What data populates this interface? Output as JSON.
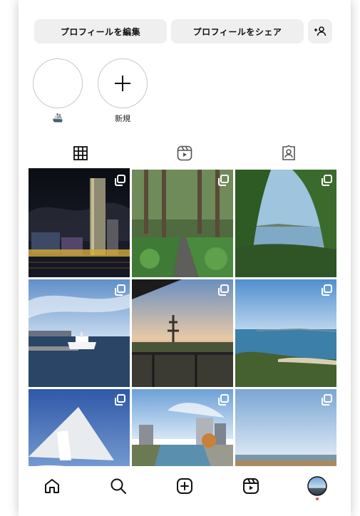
{
  "profile_actions": {
    "edit_label": "プロフィールを編集",
    "share_label": "プロフィールをシェア",
    "add_user_icon": "add-user-icon"
  },
  "highlights": [
    {
      "label": "",
      "icon": "ship-emoji"
    },
    {
      "label": "新規",
      "icon": "plus-icon"
    }
  ],
  "highlight_emoji": "🚢",
  "tabs": [
    {
      "name": "posts",
      "icon": "grid-icon",
      "active": true
    },
    {
      "name": "reels",
      "icon": "reels-icon",
      "active": false
    },
    {
      "name": "tagged",
      "icon": "tagged-person-icon",
      "active": false
    }
  ],
  "posts": [
    {
      "subject": "night city skyline with tower and harbor",
      "multi": true
    },
    {
      "subject": "forest path between tall cedars",
      "multi": true
    },
    {
      "subject": "bay view through green trees",
      "multi": true
    },
    {
      "subject": "white ship at pier under blue sky",
      "multi": true
    },
    {
      "subject": "sunset over trees from balcony",
      "multi": true
    },
    {
      "subject": "sea and islands from hilltop",
      "multi": true
    },
    {
      "subject": "white monument against blue sky",
      "multi": true
    },
    {
      "subject": "river canal with city buildings",
      "multi": true
    },
    {
      "subject": "sandy dunes and calm sea",
      "multi": true
    }
  ],
  "bottom_nav": [
    {
      "name": "home",
      "icon": "home-icon"
    },
    {
      "name": "search",
      "icon": "search-icon"
    },
    {
      "name": "create",
      "icon": "create-post-icon"
    },
    {
      "name": "reels",
      "icon": "reels-icon"
    },
    {
      "name": "profile",
      "icon": "profile-avatar",
      "notification_dot": true
    }
  ],
  "colors": {
    "button_bg": "#efefef",
    "text": "#111111",
    "notification": "#ed4956"
  }
}
